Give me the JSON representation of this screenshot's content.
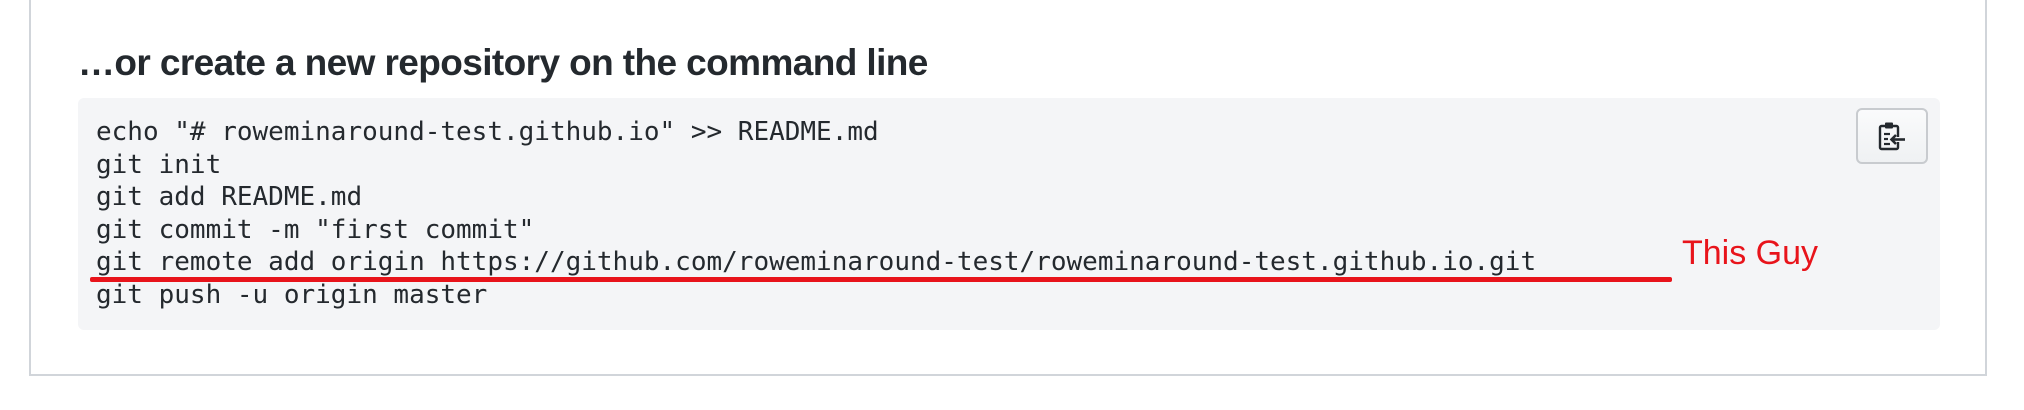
{
  "section": {
    "heading": "…or create a new repository on the command line",
    "code_lines": [
      "echo \"# roweminaround-test.github.io\" >> README.md",
      "git init",
      "git add README.md",
      "git commit -m \"first commit\"",
      "git remote add origin https://github.com/roweminaround-test/roweminaround-test.github.io.git",
      "git push -u origin master"
    ],
    "copy_button_icon": "clipboard-icon"
  },
  "annotation": {
    "label": "This Guy",
    "color": "#e8141b"
  },
  "colors": {
    "text": "#24292e",
    "code_background": "#f4f5f7",
    "border": "#d1d5da"
  }
}
